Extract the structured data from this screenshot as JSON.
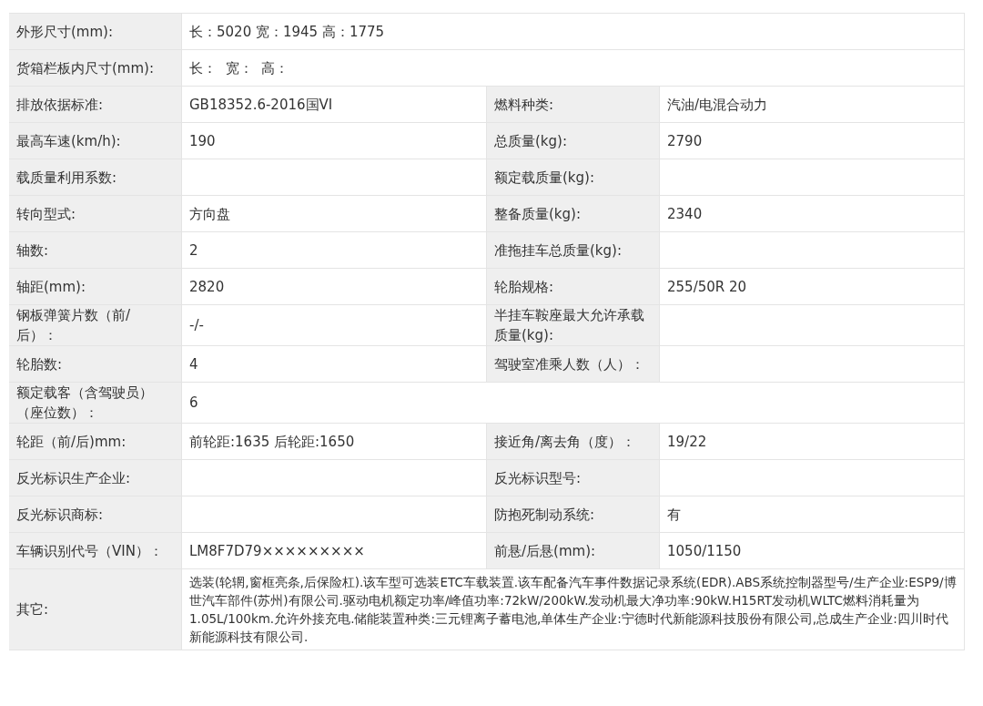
{
  "spec_table": {
    "rows": [
      {
        "kind": "wide",
        "label": "外形尺寸(mm):",
        "value": "长：5020 宽：1945 高：1775"
      },
      {
        "kind": "wide",
        "label": "货箱栏板内尺寸(mm):",
        "value": "长：  宽：  高："
      },
      {
        "kind": "pair",
        "label": "排放依据标准:",
        "value": "GB18352.6-2016国VI",
        "label2": "燃料种类:",
        "value2": "汽油/电混合动力"
      },
      {
        "kind": "pair",
        "label": "最高车速(km/h):",
        "value": "190",
        "label2": "总质量(kg):",
        "value2": "2790"
      },
      {
        "kind": "pair",
        "label": "载质量利用系数:",
        "label2": "额定载质量(kg):"
      },
      {
        "kind": "pair",
        "label": "转向型式:",
        "value": "方向盘",
        "label2": "整备质量(kg):",
        "value2": "2340"
      },
      {
        "kind": "pair",
        "label": "轴数:",
        "value": "2",
        "label2": "准拖挂车总质量(kg):"
      },
      {
        "kind": "pair",
        "label": "轴距(mm):",
        "value": "2820",
        "label2": "轮胎规格:",
        "value2": "255/50R 20"
      },
      {
        "kind": "pair",
        "label": "钢板弹簧片数（前/后）：",
        "value": "-/-",
        "label2": "半挂车鞍座最大允许承载质量(kg):"
      },
      {
        "kind": "pair",
        "label": "轮胎数:",
        "value": "4",
        "label2": "驾驶室准乘人数（人）："
      },
      {
        "kind": "wide",
        "label": "额定载客（含驾驶员）（座位数）：",
        "value": "6"
      },
      {
        "kind": "pair",
        "label": "轮距（前/后)mm:",
        "value": "前轮距:1635 后轮距:1650",
        "label2": "接近角/离去角（度）：",
        "value2": "19/22"
      },
      {
        "kind": "pair",
        "label": "反光标识生产企业:",
        "label2": "反光标识型号:"
      },
      {
        "kind": "pair",
        "label": "反光标识商标:",
        "label2": "防抱死制动系统:",
        "value2": "有"
      },
      {
        "kind": "pair",
        "label": "车辆识别代号（VIN）：",
        "value": "LM8F7D79×××××××××",
        "label2": "前悬/后悬(mm):",
        "value2": "1050/1150"
      },
      {
        "kind": "note",
        "label": "其它:",
        "value": "选装(轮辋,窗框亮条,后保险杠).该车型可选装ETC车载装置.该车配备汽车事件数据记录系统(EDR).ABS系统控制器型号/生产企业:ESP9/博世汽车部件(苏州)有限公司.驱动电机额定功率/峰值功率:72kW/200kW.发动机最大净功率:90kW.H15RT发动机WLTC燃料消耗量为1.05L/100km.允许外接充电.储能装置种类:三元锂离子蓄电池,单体生产企业:宁德时代新能源科技股份有限公司,总成生产企业:四川时代新能源科技有限公司."
      }
    ]
  }
}
